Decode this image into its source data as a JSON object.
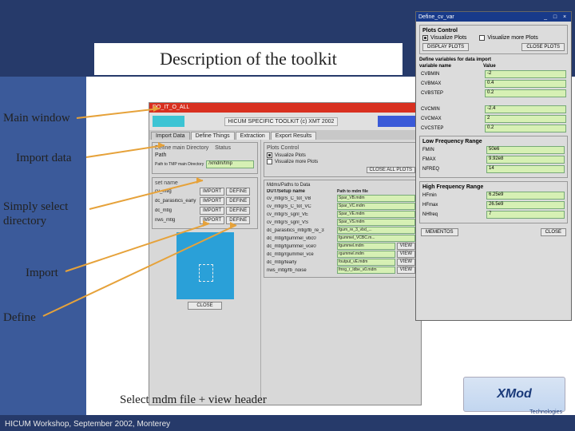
{
  "slide": {
    "title": "Description of the toolkit",
    "subtitle": "Select mdm file + view header",
    "footer": "HICUM Workshop, September 2002, Monterey",
    "logo_text": "XMod",
    "logo_sub": "Technologies"
  },
  "annotations": {
    "main_window": "Main window",
    "import_data": "Import data",
    "select_dir": "Simply select directory",
    "import": "Import",
    "define": "Define"
  },
  "main_win": {
    "titlebar": "DO_IT_O_ALL",
    "header_label": "HICUM SPECIFIC TOOLKIT   (c) XMT  2002",
    "tabs": [
      "Import Data",
      "Define Things",
      "Extraction",
      "Export Results"
    ],
    "define_dir": {
      "title": "Define main Directory",
      "col2": "Status",
      "path_label": "Path",
      "path_hint": "Path to TMP main Directory",
      "path_value": "/xmdm/tmp"
    },
    "sets": {
      "col1": "set name",
      "items": [
        "cv_mtlg",
        "dc_parasitics_early",
        "dc_mtlg",
        "nws_mtlg"
      ],
      "import_btn": "IMPORT",
      "define_btn": "DEFINE"
    },
    "close_btn": "CLOSE",
    "plots_ctrl": {
      "title": "Plots Control",
      "vis": "Visualize Plots",
      "vis_more": "Visualize more Plots",
      "close_all": "CLOSE ALL PLOTS"
    },
    "data_list": {
      "title": "Mdms/Paths to Data",
      "sub": "DUT/Setup name",
      "path_col": "Path to mdm file",
      "view_btn": "VIEW",
      "rows": [
        {
          "name": "cv_mtlg/S_C_tot_VB",
          "file": "Spar_VB.mdm"
        },
        {
          "name": "cv_mtlg/S_C_tot_VC",
          "file": "Spar_VC.mdm"
        },
        {
          "name": "cv_mtlg/S_sgnl_VE",
          "file": "Spar_VE.mdm"
        },
        {
          "name": "cv_mtlg/S_sgnl_VS",
          "file": "Spar_VS.mdm"
        },
        {
          "name": "dc_parasitics_mtlg/fb_re_3",
          "file": "fgum_re_3_vbd_..."
        },
        {
          "name": "dc_mtlg/fgummel_vbc0",
          "file": "fgummel_VCBC.m..."
        },
        {
          "name": "dc_mtlg/fgummel_vce0",
          "file": "fgummel.mdm"
        },
        {
          "name": "dc_mtlg/rgummel_vce",
          "file": "rgummel.mdm"
        },
        {
          "name": "dc_mtlg/fearly",
          "file": "foutput_vE.mdm"
        },
        {
          "name": "nws_mtlg/fb_noise",
          "file": "fmrg_r_Idbe_v0.mdm"
        }
      ]
    }
  },
  "popup": {
    "title": "Define_cv_var",
    "plots": {
      "title": "Plots Control",
      "vis": "Visualize Plots",
      "vis_more": "Visualize more Plots",
      "display_btn": "DISPLAY PLOTS",
      "close_btn": "CLOSE PLOTS"
    },
    "vars": {
      "title": "Define variables for data import",
      "col_name": "variable name",
      "col_val": "Value",
      "rows1": [
        {
          "name": "CVBMIN",
          "value": "-2"
        },
        {
          "name": "CVBMAX",
          "value": "0.4"
        },
        {
          "name": "CVBSTEP",
          "value": "0.2"
        }
      ],
      "rows2": [
        {
          "name": "CVCMIN",
          "value": "-2.4"
        },
        {
          "name": "CVCMAX",
          "value": "2"
        },
        {
          "name": "CVCSTEP",
          "value": "0.2"
        }
      ]
    },
    "lf": {
      "title": "Low Frequency Range",
      "rows": [
        {
          "name": "FMIN",
          "value": "50e6"
        },
        {
          "name": "FMAX",
          "value": "9.92e8"
        },
        {
          "name": "NFREQ",
          "value": "14"
        }
      ]
    },
    "hf": {
      "title": "High Frequency Range",
      "rows": [
        {
          "name": "HFmin",
          "value": "6.25e9"
        },
        {
          "name": "HFmax",
          "value": "26.5e9"
        },
        {
          "name": "NHfreq",
          "value": "7"
        }
      ]
    },
    "mementos_btn": "MEMENTOS",
    "close_btn": "CLOSE"
  }
}
